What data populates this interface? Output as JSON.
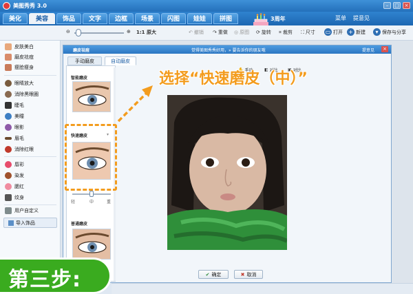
{
  "app": {
    "title": "美图秀秀 3.0"
  },
  "tabs": [
    {
      "label": "美化"
    },
    {
      "label": "美容"
    },
    {
      "label": "饰品"
    },
    {
      "label": "文字"
    },
    {
      "label": "边框"
    },
    {
      "label": "场景"
    },
    {
      "label": "闪图"
    },
    {
      "label": "娃娃"
    },
    {
      "label": "拼图"
    }
  ],
  "header": {
    "anniversary": "3周年",
    "menu": "菜单",
    "feedback": "提意见"
  },
  "toolbar": {
    "original_size": "1:1 原大",
    "undo": "撤销",
    "redo": "重做",
    "restore": "原图",
    "rotate": "旋转",
    "crop": "裁剪",
    "resize": "尺寸",
    "open": "打开",
    "new": "新建",
    "save_share": "保存与分享"
  },
  "sidebar": {
    "items": [
      {
        "label": "皮肤美白",
        "color": "#e8a87c"
      },
      {
        "label": "磨皮祛痘",
        "color": "#d98c6a"
      },
      {
        "label": "瘦脸瘦身",
        "color": "#c97b5a"
      },
      {
        "label": "眼睛放大",
        "color": "#7a5c3e"
      },
      {
        "label": "消除黑眼圈",
        "color": "#8a6a50"
      },
      {
        "label": "睫毛",
        "color": "#333333"
      },
      {
        "label": "美瞳",
        "color": "#3d7fc4"
      },
      {
        "label": "眼影",
        "color": "#8e5aa8"
      },
      {
        "label": "眉毛",
        "color": "#6b4a2e"
      },
      {
        "label": "消除红眼",
        "color": "#c0392b"
      },
      {
        "label": "唇彩",
        "color": "#e74c6c"
      },
      {
        "label": "染发",
        "color": "#a0522d"
      },
      {
        "label": "腮红",
        "color": "#f08ca0"
      },
      {
        "label": "纹身",
        "color": "#555555"
      },
      {
        "label": "用户自定义",
        "color": "#7f8c8d"
      }
    ],
    "import_label": "导入饰品"
  },
  "dialog": {
    "title": "磨皮祛痘",
    "banner": "觉得美图秀秀好用，» 要告诉你的朋友哦",
    "feedback": "提意见",
    "tab_manual": "手动磨皮",
    "tab_auto": "自动磨皮",
    "presets": {
      "smart": "智能磨皮",
      "fast": "快速磨皮",
      "normal": "普通磨皮",
      "slider_light": "轻",
      "slider_mid": "中",
      "slider_heavy": "重",
      "fast_level": 0.5
    },
    "mini_tools": {
      "hand": "手动",
      "compare": "对比",
      "compare_hold": "对比"
    },
    "ok": "确定",
    "cancel": "取消"
  },
  "annotation": {
    "instruction": "选择“快速磨皮（中）”",
    "step": "第三步:",
    "color": "#f39c1e",
    "badge_color": "#3aab1f"
  }
}
